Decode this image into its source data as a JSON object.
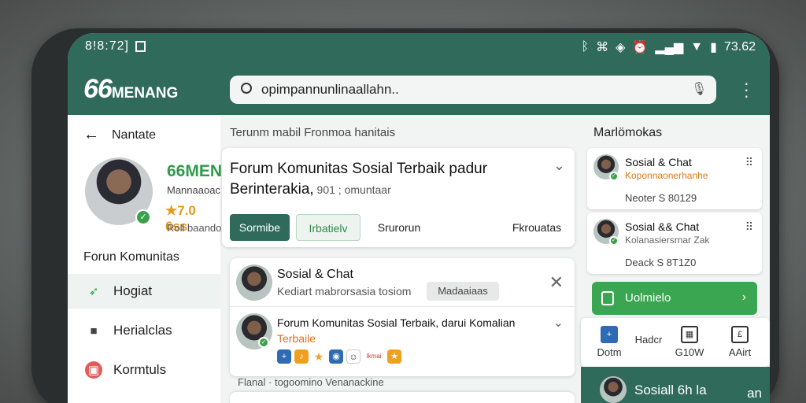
{
  "status": {
    "time": "8!8:72]",
    "right_time": "73.62"
  },
  "header": {
    "logo_num": "66",
    "logo_text": "MENANG",
    "search_value": "opimpannunlinaallahn..",
    "menu_icon": "kebab-icon"
  },
  "profile": {
    "back_label": "Nantate",
    "brand": "66MEN",
    "subtitle": "Mannaaoac",
    "rating": "★7.0 6ss",
    "meta": "Roll baandor"
  },
  "sidebar": {
    "section_title": "Forun Komunitas",
    "items": [
      {
        "label": "Hogiat",
        "icon": "leaf-icon"
      },
      {
        "label": "Herialclas",
        "icon": "briefcase-icon"
      },
      {
        "label": "Kormtuls",
        "icon": "badge-icon"
      }
    ]
  },
  "main": {
    "heading": "Terunm mabil Fronmoa hanitais",
    "card_title_line1": "Forum Komunitas Sosial Terbaik padur",
    "card_title_line2": "Berinterakia,",
    "card_title_meta": " 901 ; omuntaar",
    "btn_primary": "Sormibe",
    "btn_secondary": "Irbatielv",
    "btn_plain": "Srurorun",
    "btn_plain2": "Fkrouatas",
    "list": {
      "row1_name": "Sosial & Chat",
      "row1_desc": "Kediart mabrorsasia tosiom",
      "row1_pill": "Madaaiaas",
      "row2_title": "Forum Komunitas Sosial Terbaik, darui Komalian",
      "row2_tag": "Terbaile",
      "emojis": [
        "+",
        "♪",
        "★",
        "◉",
        "☺",
        "Ikmai",
        "★"
      ]
    },
    "footer_text": "Flanal · togoomino Venanackine"
  },
  "right": {
    "heading": "Marlömokas",
    "cards": [
      {
        "name": "Sosial & Chat",
        "desc": "Koponnaonerhanhe",
        "count": "Neoter S 80129"
      },
      {
        "name": "Sosial && Chat",
        "desc": "Kolanasiersrnar Zak",
        "count": "Deack S 8T1Z0"
      }
    ],
    "green_button": "Uolmielo",
    "bottom_nav": [
      {
        "label": "Dotm",
        "icon": "plus-icon"
      },
      {
        "label": "Hadcr",
        "icon": "grid-icon"
      },
      {
        "label": "G10W",
        "icon": "calendar-icon"
      },
      {
        "label": "AAirt",
        "icon": "doc-icon"
      }
    ],
    "corner_name": "Sosiall 6h la",
    "corner_more": "an"
  }
}
